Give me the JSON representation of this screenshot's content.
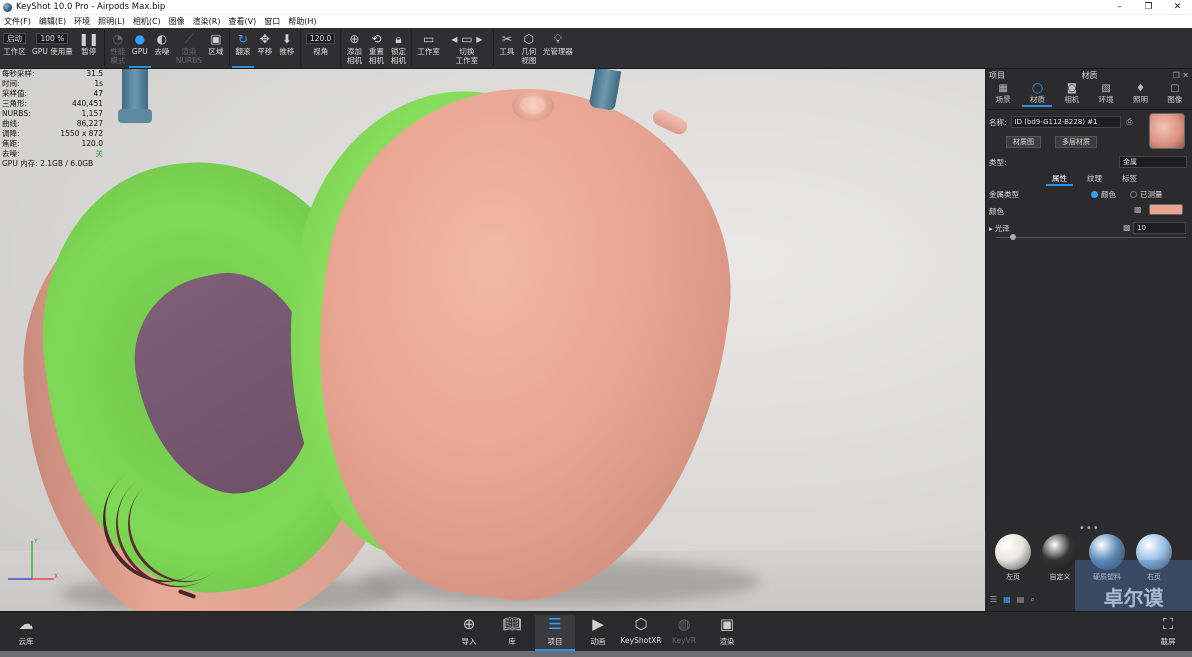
{
  "window": {
    "title": "KeyShot 10.0 Pro  - Airpods Max.bip",
    "controls": [
      "–",
      "❐",
      "✕"
    ]
  },
  "menu": [
    "文件(F)",
    "编辑(E)",
    "环境",
    "照明(L)",
    "相机(C)",
    "图像",
    "渲染(R)",
    "查看(V)",
    "窗口",
    "帮助(H)"
  ],
  "toolbar": {
    "workspace": {
      "value": "启动",
      "label": "工作区"
    },
    "gpu_usage": {
      "value": "100 %",
      "label": "GPU 使用量"
    },
    "pause": "暂停",
    "perf_mode": "性能\n模式",
    "gpu": "GPU",
    "denoise": "去噪",
    "render_nurbs": "渲染\nNURBS",
    "region": "区域",
    "tumble": "翻滚",
    "pan": "平移",
    "dolly": "推移",
    "fov": {
      "value": "120.0",
      "label": "视角"
    },
    "add_camera": "添加\n相机",
    "reset_camera": "重置\n相机",
    "lock_camera": "锁定\n相机",
    "studio": "工作室",
    "switch_studio": "切换\n工作室",
    "tools": "工具",
    "geometry_view": "几何\n视图",
    "light_manager": "光管理器"
  },
  "stats": [
    {
      "k": "每秒采样:",
      "v": "31.5"
    },
    {
      "k": "时间:",
      "v": "1s"
    },
    {
      "k": "采样值:",
      "v": "47"
    },
    {
      "k": "三角形:",
      "v": "440,451"
    },
    {
      "k": "NURBS:",
      "v": "1,157"
    },
    {
      "k": "曲线:",
      "v": "86,227"
    },
    {
      "k": "调降:",
      "v": "1550 x 872"
    },
    {
      "k": "焦距:",
      "v": "120.0"
    },
    {
      "k": "去噪:",
      "v": "关"
    },
    {
      "k": "GPU 内存: 2.1GB / 6.0GB",
      "v": ""
    }
  ],
  "panel": {
    "left_title": "项目",
    "center_title": "材质",
    "tabs": [
      "场景",
      "材质",
      "相机",
      "环境",
      "照明",
      "图像"
    ],
    "name_label": "名称:",
    "name_value": "ID (bd9-G112-B228) #1",
    "material_graph": "材质图",
    "multi_material": "多层材质",
    "type_label": "类型:",
    "type_value": "金属",
    "subtabs": [
      "属性",
      "纹理",
      "标签"
    ],
    "metal_type_label": "金属类型",
    "radio_color": "颜色",
    "radio_measured": "已测量",
    "color_label": "颜色",
    "color_hex": "#e8a592",
    "roughness_label": "光泽",
    "roughness_value": "10"
  },
  "materials": [
    {
      "label": "左页",
      "color": "#e8e6e0"
    },
    {
      "label": "自定义",
      "color": "#333333"
    },
    {
      "label": "硬质塑料",
      "color": "#5f8fb8"
    },
    {
      "label": "右页",
      "color": "#9cc2e6"
    }
  ],
  "bottombar": [
    "云库",
    "导入",
    "库",
    "项目",
    "动画",
    "KeyShotXR",
    "KeyVR",
    "渲染",
    "截屏"
  ],
  "watermark": "卓尔谟"
}
